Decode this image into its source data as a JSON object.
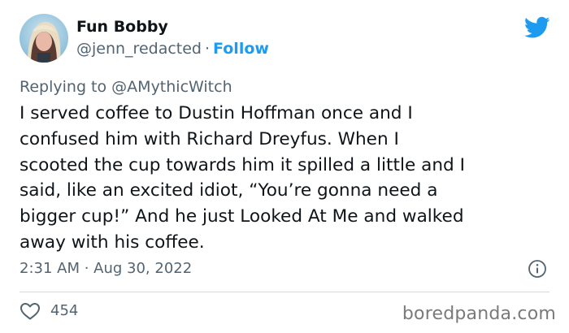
{
  "author": {
    "display_name": "Fun Bobby",
    "handle": "@jenn_redacted",
    "separator": "·",
    "follow_label": "Follow"
  },
  "reply": {
    "prefix": "Replying to",
    "mention": "@AMythicWitch"
  },
  "tweet": {
    "text": "I served coffee to Dustin Hoffman once and I\nconfused him with Richard Dreyfus. When I\nscooted the cup towards him it spilled a little and I\nsaid, like an excited idiot, “You’re gonna need a\nbigger cup!” And he just Looked At Me and walked\naway with his coffee.",
    "timestamp": "2:31 AM · Aug 30, 2022"
  },
  "engagement": {
    "likes": "454"
  },
  "watermark": "boredpanda.com",
  "icons": {
    "logo": "twitter-bird-icon",
    "info": "info-icon",
    "like": "heart-icon"
  },
  "colors": {
    "accent": "#1d9bf0",
    "muted": "#536471",
    "text": "#0f1419",
    "divider": "#cfd9de"
  }
}
